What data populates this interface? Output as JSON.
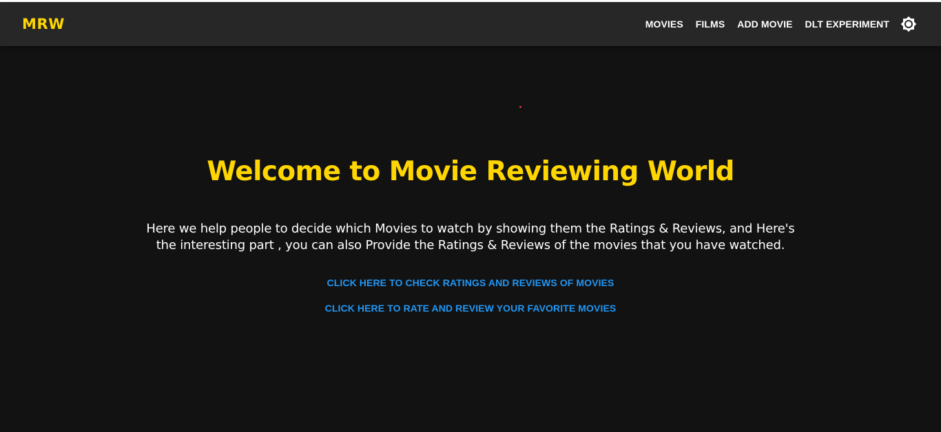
{
  "navbar": {
    "brand": "MRW",
    "links": [
      {
        "label": "MOVIES"
      },
      {
        "label": "FILMS"
      },
      {
        "label": "ADD MOVIE"
      },
      {
        "label": "DLT EXPERIMENT"
      }
    ],
    "theme_toggle_icon": "brightness-icon"
  },
  "hero": {
    "title": "Welcome to Movie Reviewing World",
    "description_line1": "Here we help people to decide which Movies to watch by showing them the Ratings & Reviews, and Here's",
    "description_line2": "the interesting part , you can also Provide the Ratings & Reviews of the movies that you have watched.",
    "cta_check": "CLICK HERE TO CHECK RATINGS AND REVIEWS OF MOVIES",
    "cta_rate": "CLICK HERE TO RATE AND REVIEW YOUR FAVORITE MOVIES"
  },
  "colors": {
    "background": "#121212",
    "navbar": "#272727",
    "accent_yellow": "#FFD600",
    "link_blue": "#2196F3",
    "text": "#ffffff"
  }
}
